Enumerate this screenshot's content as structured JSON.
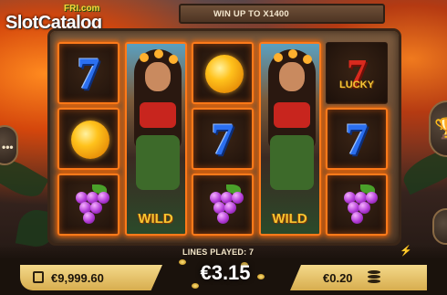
{
  "logo": {
    "small_text": "FRI.com",
    "main_text": "SlotCatalog"
  },
  "header": {
    "win_banner": "WIN UP TO X1400"
  },
  "reels": [
    {
      "type": "symbols",
      "symbols": [
        "blue-seven",
        "orange",
        "grapes"
      ]
    },
    {
      "type": "wild",
      "label": "WILD"
    },
    {
      "type": "symbols",
      "symbols": [
        "orange",
        "blue-seven",
        "grapes"
      ]
    },
    {
      "type": "wild",
      "label": "WILD"
    },
    {
      "type": "symbols",
      "symbols": [
        "lucky-seven",
        "blue-seven",
        "grapes"
      ]
    }
  ],
  "symbol_text": {
    "seven": "7",
    "lucky": "LUCKY"
  },
  "status": {
    "lines_played": "LINES PLAYED: 7"
  },
  "footer": {
    "balance": "€9,999.60",
    "win": "€3.15",
    "bet": "€0.20"
  },
  "controls": {
    "menu_glyph": "•••",
    "trophy_glyph": "🏆",
    "lightning_glyph": "⚡"
  },
  "colors": {
    "win_highlight": "#ff7a1a",
    "pill_gold": "#e2bd62",
    "seven_blue": "#2b6ff0"
  }
}
